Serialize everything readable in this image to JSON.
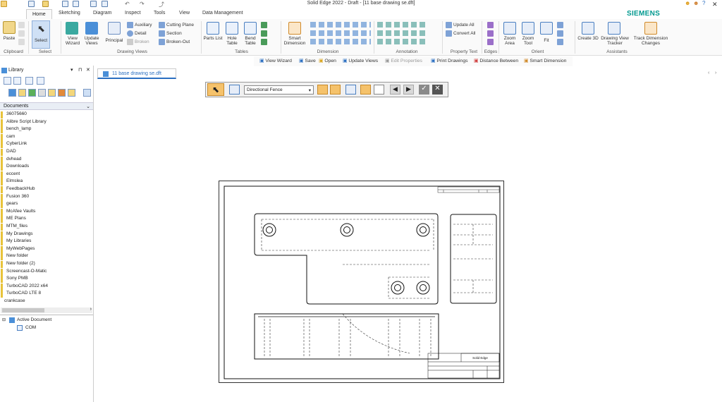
{
  "window": {
    "title": "Solid Edge 2022 - Draft - [11 base drawing se.dft]",
    "brand": "SIEMENS",
    "controls": [
      "–",
      "▭",
      "✕"
    ]
  },
  "ribbon_tabs": [
    "Home",
    "Sketching",
    "Diagram",
    "Inspect",
    "Tools",
    "View",
    "Data Management"
  ],
  "ribbon": {
    "clipboard": {
      "paste": "Paste",
      "group": "Clipboard"
    },
    "select": {
      "select": "Select",
      "group": "Select"
    },
    "drawing_views": {
      "view_wizard": "View Wizard",
      "update_views": "Update Views",
      "principal": "Principal",
      "auxiliary": "Auxiliary",
      "detail": "Detail",
      "broken": "Broken",
      "cutting_plane": "Cutting Plane",
      "section": "Section",
      "broken_out": "Broken-Out",
      "group": "Drawing Views"
    },
    "tables": {
      "parts_list": "Parts List",
      "hole_table": "Hole Table",
      "bend_table": "Bend Table",
      "group": "Tables"
    },
    "dimension": {
      "smart_dimension": "Smart Dimension",
      "group": "Dimension"
    },
    "annotation": {
      "group": "Annotation"
    },
    "property_text": {
      "update_all": "Update All",
      "convert_all": "Convert All",
      "group": "Property Text"
    },
    "edges": {
      "group": "Edges"
    },
    "orient": {
      "zoom_area": "Zoom Area",
      "zoom_tool": "Zoom Tool",
      "fit": "Fit",
      "group": "Orient"
    },
    "assistants": {
      "create_3d": "Create 3D",
      "drawing_view_tracker": "Drawing View Tracker",
      "track_dimension_changes": "Track Dimension Changes",
      "group": "Assistants"
    }
  },
  "subtoolbar": [
    "View Wizard",
    "Save",
    "Open",
    "Update Views",
    "Edit Properties",
    "Print Drawings",
    "Distance Between",
    "Smart Dimension"
  ],
  "library": {
    "title": "Library",
    "documents_header": "Documents",
    "files": [
      "36075660",
      "Alibre Script Library",
      "bench_lamp",
      "cam",
      "CyberLink",
      "DAD",
      "dvhead",
      "Downloads",
      "eccent",
      "Elmslea",
      "FeedbackHub",
      "Fusion 360",
      "gears",
      "McAfee Vaults",
      "ME Plans",
      "MTM_files",
      "My Drawings",
      "My Libraries",
      "MyWebPages",
      "New folder",
      "New folder (2)",
      "Screencast-O-Matic",
      "Sony PMB",
      "TurboCAD 2022 x64",
      "TurboCAD LTE 8",
      "crankcase"
    ],
    "tree": {
      "active_document": "Active Document",
      "child": "COM"
    }
  },
  "document_tab": {
    "label": "11 base drawing se.dft"
  },
  "fence_toolbar": {
    "mode": "Directional Fence"
  },
  "title_block": {
    "company": "Solid Edge"
  },
  "colors": {
    "accent": "#2b6fc1",
    "brand": "#00998f",
    "selected": "#f5c26b",
    "folder": "#e8c33a"
  }
}
